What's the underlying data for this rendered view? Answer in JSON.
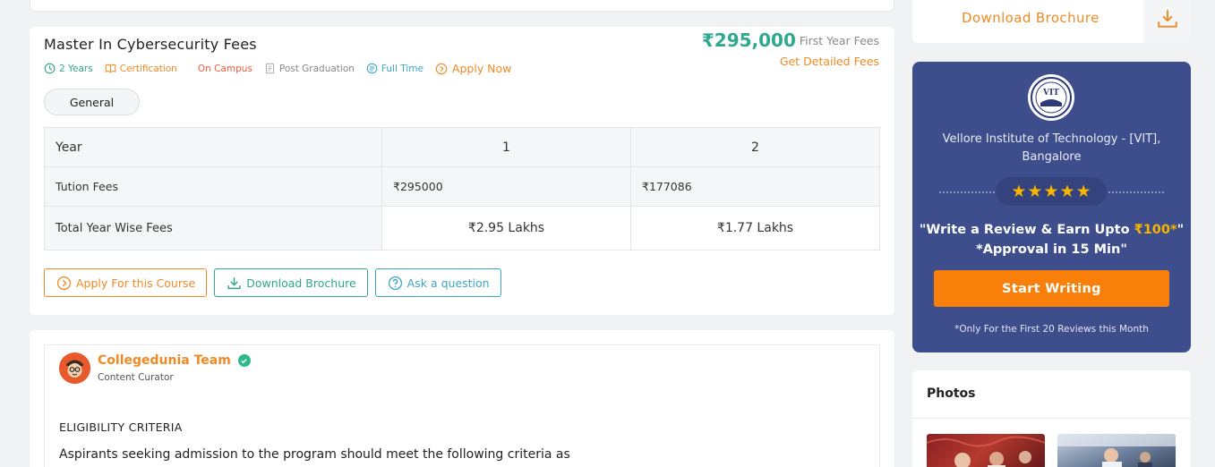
{
  "fees": {
    "title": "Master In Cybersecurity Fees",
    "meta": {
      "duration": "2 Years",
      "certification": "Certification",
      "mode": "On Campus",
      "level": "Post Graduation",
      "type": "Full Time",
      "apply_now": "Apply Now"
    },
    "price": "₹295,000",
    "price_label": "First Year Fees",
    "detailed_link": "Get Detailed Fees",
    "category": "General",
    "table": {
      "header": [
        "Year",
        "1",
        "2"
      ],
      "tuition": [
        "Tution Fees",
        "₹295000",
        "₹177086"
      ],
      "total": [
        "Total Year Wise Fees",
        "₹2.95 Lakhs",
        "₹1.77 Lakhs"
      ]
    },
    "buttons": {
      "apply": "Apply For this Course",
      "brochure": "Download Brochure",
      "ask": "Ask a question"
    }
  },
  "article": {
    "author": "Collegedunia Team",
    "role": "Content Curator",
    "heading": "ELIGIBILITY CRITERIA",
    "text": "Aspirants seeking admission to the program should meet the following criteria as"
  },
  "sidebar": {
    "download_label": "Download Brochure",
    "review": {
      "logo_text": "VIT",
      "college": "Vellore Institute of Technology - [VIT], Bangalore",
      "stars": 5,
      "line1_prefix": "\"Write a Review & Earn Upto ",
      "line1_amount": "₹100*",
      "line1_suffix": "\"",
      "line2": "*Approval in 15 Min\"",
      "button": "Start Writing",
      "note": "*Only For the First 20 Reviews this Month"
    },
    "photos_title": "Photos"
  },
  "colors": {
    "accent_orange": "#f08a24",
    "accent_teal": "#2fa88e",
    "review_bg": "#3e4d8c",
    "star": "#f7b500"
  }
}
